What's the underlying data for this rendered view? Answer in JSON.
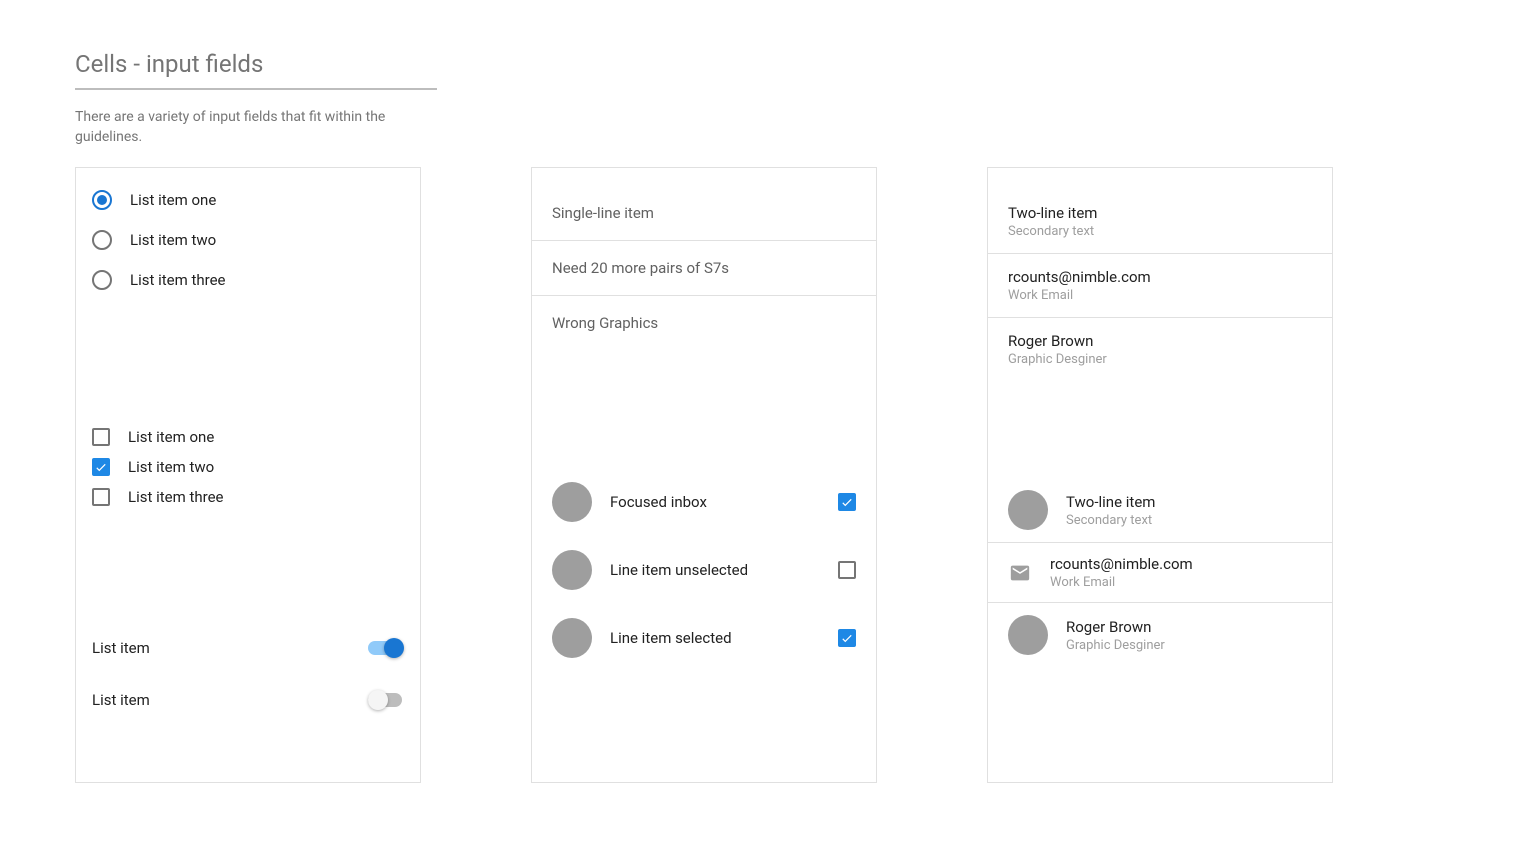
{
  "header": {
    "title": "Cells - input fields",
    "description": "There are a variety of input fields that fit within the guidelines."
  },
  "col1": {
    "radios": [
      {
        "label": "List item one",
        "selected": true
      },
      {
        "label": "List item two",
        "selected": false
      },
      {
        "label": "List item three",
        "selected": false
      }
    ],
    "checkboxes": [
      {
        "label": "List item one",
        "checked": false
      },
      {
        "label": "List item two",
        "checked": true
      },
      {
        "label": "List item three",
        "checked": false
      }
    ],
    "switches": [
      {
        "label": "List item",
        "on": true
      },
      {
        "label": "List item",
        "on": false
      }
    ]
  },
  "col2": {
    "single_items": [
      "Single-line item",
      "Need 20 more pairs of S7s",
      "Wrong Graphics"
    ],
    "avatar_items": [
      {
        "label": "Focused inbox",
        "checked": true
      },
      {
        "label": "Line item unselected",
        "checked": false
      },
      {
        "label": "Line item selected",
        "checked": true
      }
    ]
  },
  "col3": {
    "two_line_items": [
      {
        "primary": "Two-line item",
        "secondary": "Secondary text"
      },
      {
        "primary": "rcounts@nimble.com",
        "secondary": "Work Email"
      },
      {
        "primary": "Roger Brown",
        "secondary": "Graphic Desginer"
      }
    ],
    "two_line_icon_items": [
      {
        "icon": "avatar",
        "primary": "Two-line item",
        "secondary": "Secondary text"
      },
      {
        "icon": "mail",
        "primary": "rcounts@nimble.com",
        "secondary": "Work Email"
      },
      {
        "icon": "avatar",
        "primary": "Roger Brown",
        "secondary": "Graphic Desginer"
      }
    ]
  }
}
